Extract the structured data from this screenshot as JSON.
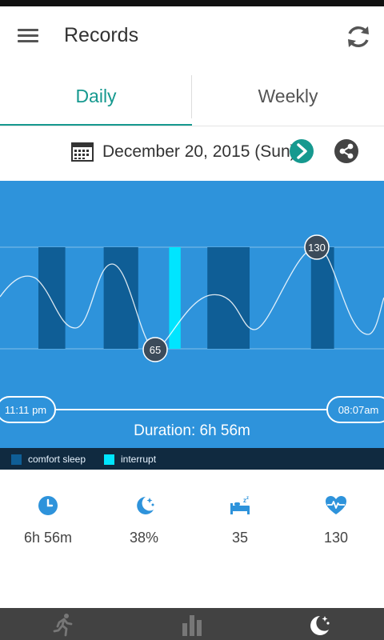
{
  "app": {
    "title": "Records"
  },
  "icons": {
    "menu": "menu-icon",
    "refresh": "refresh-icon",
    "calendar": "calendar-icon",
    "next": "chevron-right-icon",
    "share": "share-icon",
    "clock": "clock-icon",
    "moon": "moon-stars-icon",
    "bed": "bed-icon",
    "heart": "heart-pulse-icon"
  },
  "tabs": [
    {
      "label": "Daily",
      "active": true
    },
    {
      "label": "Weekly",
      "active": false
    }
  ],
  "date": {
    "label": "December 20, 2015 (Sun)"
  },
  "chart": {
    "start_time": "11:11 pm",
    "end_time": "08:07am",
    "duration_label": "Duration: 6h 56m",
    "min_marker": "65",
    "max_marker": "130"
  },
  "legend": [
    {
      "label": "comfort sleep",
      "color": "#0f5e96"
    },
    {
      "label": "interrupt",
      "color": "#00e5ff"
    }
  ],
  "stats": [
    {
      "icon": "clock-icon",
      "value": "6h 56m"
    },
    {
      "icon": "moon-stars-icon",
      "value": "38%"
    },
    {
      "icon": "bed-icon",
      "value": "35"
    },
    {
      "icon": "heart-pulse-icon",
      "value": "130"
    }
  ],
  "colors": {
    "accent": "#16998f",
    "chart_bg": "#2e93db",
    "comfort_sleep": "#0f5e96",
    "interrupt": "#00e5ff",
    "stat_icon": "#2e93db",
    "nav_bg": "#424242"
  },
  "bottom_nav": [
    {
      "icon": "running-icon",
      "active": false
    },
    {
      "icon": "bar-chart-icon",
      "active": false
    },
    {
      "icon": "moon-stars-icon",
      "active": true
    }
  ],
  "chart_data": {
    "type": "line",
    "title": "",
    "xlabel": "",
    "ylabel": "",
    "time_range": [
      "11:11 pm",
      "08:07am"
    ],
    "duration": "6h 56m",
    "heart_rate_min": 65,
    "heart_rate_max": 130,
    "series": [
      {
        "name": "comfort sleep",
        "kind": "segments",
        "segments": [
          [
            0.1,
            0.17
          ],
          [
            0.27,
            0.36
          ],
          [
            0.44,
            0.47
          ],
          [
            0.54,
            0.65
          ],
          [
            0.81,
            0.87
          ]
        ]
      }
    ],
    "interrupts": [
      [
        0.44,
        0.47
      ]
    ]
  }
}
